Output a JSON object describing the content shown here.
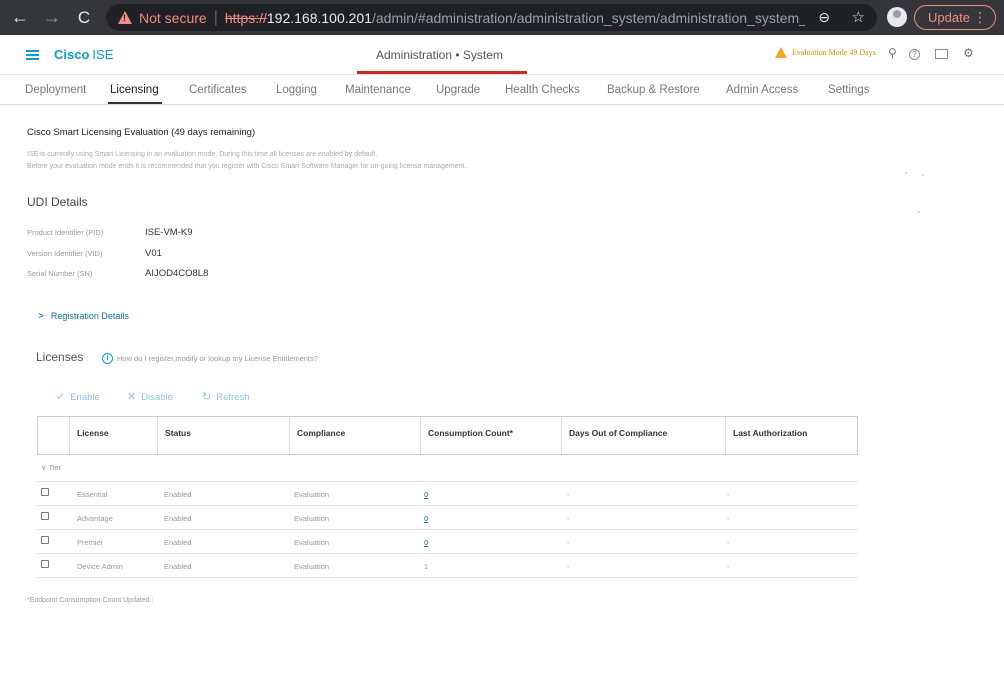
{
  "browser": {
    "nav": {
      "back": "←",
      "forward": "→",
      "reload": "C"
    },
    "security_label": "Not secure",
    "url_scheme": "https://",
    "url_host": "192.168.100.201",
    "url_path": "/admin/#administration/administration_system/administration_system_l...",
    "zoom_icon": "⊖",
    "star_icon": "☆",
    "update_label": "Update",
    "menu_icon": "⋮"
  },
  "app": {
    "brand": "Cisco",
    "product": "ISE",
    "page_title": "Administration • System",
    "eval_mode": "Evaluation Mode 49 Days",
    "icons": {
      "search": "⚲",
      "help": "?",
      "gear": "⚙"
    },
    "accent_color": "#049fd9",
    "active_color": "#e2231a"
  },
  "tabs": [
    {
      "label": "Deployment"
    },
    {
      "label": "Licensing"
    },
    {
      "label": "Certificates"
    },
    {
      "label": "Logging"
    },
    {
      "label": "Maintenance"
    },
    {
      "label": "Upgrade"
    },
    {
      "label": "Health Checks"
    },
    {
      "label": "Backup & Restore"
    },
    {
      "label": "Admin Access"
    },
    {
      "label": "Settings"
    }
  ],
  "evaluation": {
    "title": "Cisco Smart Licensing Evaluation  (49 days remaining)",
    "line1": "ISE is currently using Smart Licensing in an evaluation mode. During this time all licenses are enabled by default.",
    "line2": "Before your evaluation mode ends it is recommended that you register with Cisco Smart Software Manager for on-going license management."
  },
  "udi": {
    "heading": "UDI Details",
    "rows": [
      {
        "label": "Product Identifier (PID)",
        "value": "ISE-VM-K9"
      },
      {
        "label": "Version Identifier (VID)",
        "value": "V01"
      },
      {
        "label": "Serial Number (SN)",
        "value": "AIJOD4CO8L8"
      }
    ]
  },
  "registration": {
    "label": "Registration Details",
    "chevron": ">"
  },
  "licenses": {
    "heading": "Licenses",
    "info_icon": "i",
    "help_text": "How do I register,modify or lookup my License Entitlements?",
    "actions": [
      {
        "icon": "✓",
        "label": "Enable"
      },
      {
        "icon": "✕",
        "label": "Disable"
      },
      {
        "icon": "↻",
        "label": "Refresh"
      }
    ],
    "columns": [
      "License",
      "Status",
      "Compliance",
      "Consumption Count*",
      "Days Out of Compliance",
      "Last Authorization"
    ],
    "group_label": "∨ Tier",
    "rows": [
      {
        "license": "Essential",
        "status": "Enabled",
        "compliance": "Evaluation",
        "count": "0",
        "days": "-",
        "last": "-"
      },
      {
        "license": "Advantage",
        "status": "Enabled",
        "compliance": "Evaluation",
        "count": "0",
        "days": "-",
        "last": "-"
      },
      {
        "license": "Premier",
        "status": "Enabled",
        "compliance": "Evaluation",
        "count": "0",
        "days": "-",
        "last": "-"
      },
      {
        "license": "Device Admin",
        "status": "Enabled",
        "compliance": "Evaluation",
        "count": "1",
        "days": "-",
        "last": "-"
      }
    ],
    "footnote": "*Endpoint Consumption Count Updated :"
  }
}
